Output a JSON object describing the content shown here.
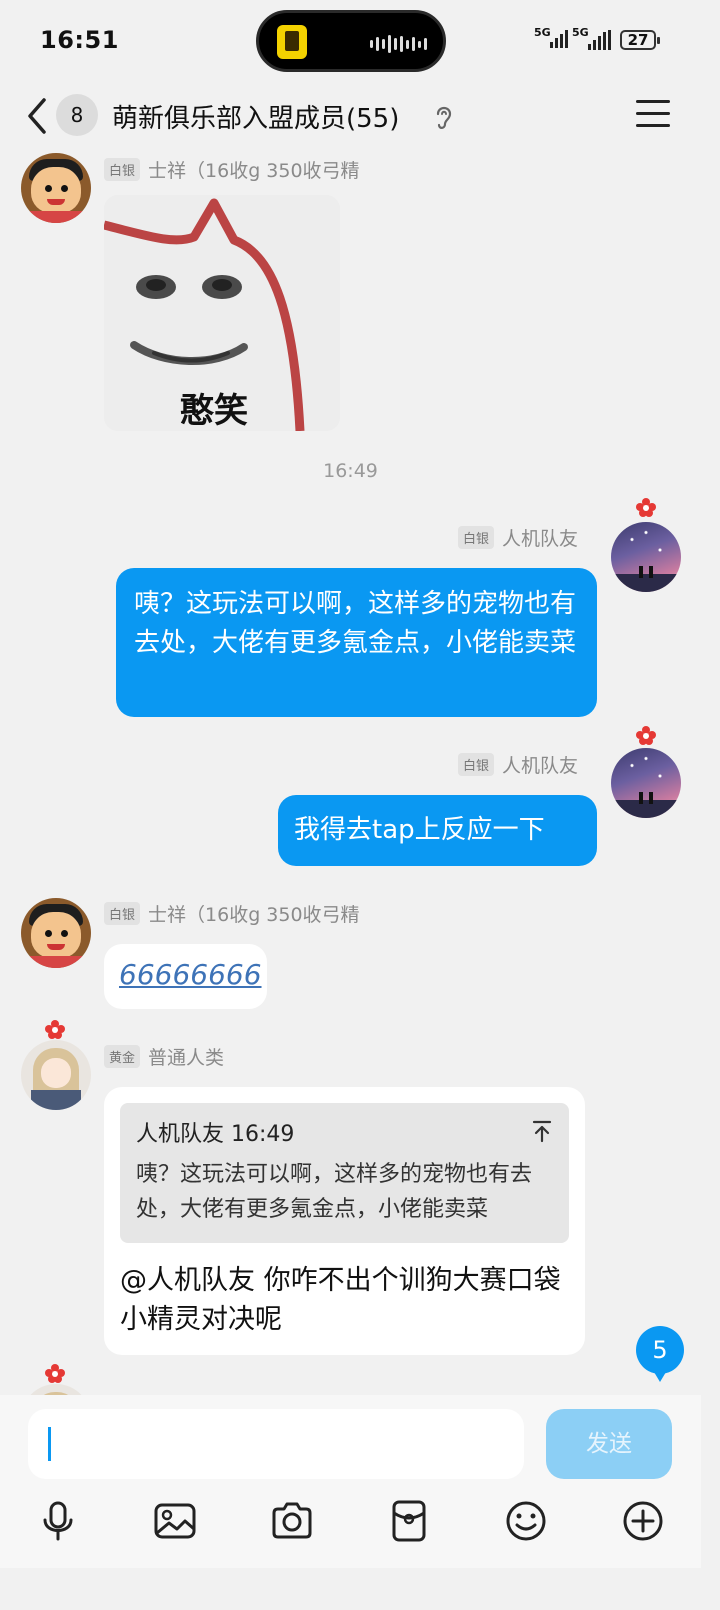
{
  "status_bar": {
    "time": "16:51",
    "battery": "27",
    "signal_1": "5G",
    "signal_2": "5G"
  },
  "header": {
    "unread_count": "8",
    "title": "萌新俱乐部入盟成员(55)"
  },
  "messages": [
    {
      "type": "sticker",
      "side": "left",
      "rank": "白银",
      "nickname": "士祥（16收g 350收弓精",
      "sticker_text": "憨笑",
      "avatar": "crayon-shin-avatar"
    },
    {
      "type": "timestamp",
      "text": "16:49"
    },
    {
      "type": "text",
      "side": "right",
      "rank": "白银",
      "nickname": "人机队友",
      "text": "咦？这玩法可以啊，这样多的宠物也有去处，大佬有更多氪金点，小佬能卖菜",
      "avatar": "starry-sky-avatar"
    },
    {
      "type": "text",
      "side": "right",
      "rank": "白银",
      "nickname": "人机队友",
      "text": "我得去tap上反应一下",
      "avatar": "starry-sky-avatar"
    },
    {
      "type": "link",
      "side": "left",
      "rank": "白银",
      "nickname": "士祥（16收g 350收弓精",
      "text": "66666666",
      "avatar": "crayon-shin-avatar"
    },
    {
      "type": "reply",
      "side": "left",
      "rank": "黄金",
      "nickname": "普通人类",
      "quote_header": "人机队友 16:49",
      "quote_text": "咦？这玩法可以啊，这样多的宠物也有去处，大佬有更多氪金点，小佬能卖菜",
      "text": "@人机队友 你咋不出个训狗大赛口袋小精灵对决呢",
      "avatar": "anime-girl-avatar"
    }
  ],
  "new_message_badge": "5",
  "input": {
    "value": "",
    "send_label": "发送"
  },
  "toolbar": [
    "microphone-icon",
    "image-icon",
    "camera-icon",
    "red-packet-icon",
    "emoji-icon",
    "plus-icon"
  ],
  "colors": {
    "accent": "#0a98f2",
    "send_disabled": "#8ccff5",
    "background": "#f1f1f1",
    "link": "#3e73b7"
  }
}
